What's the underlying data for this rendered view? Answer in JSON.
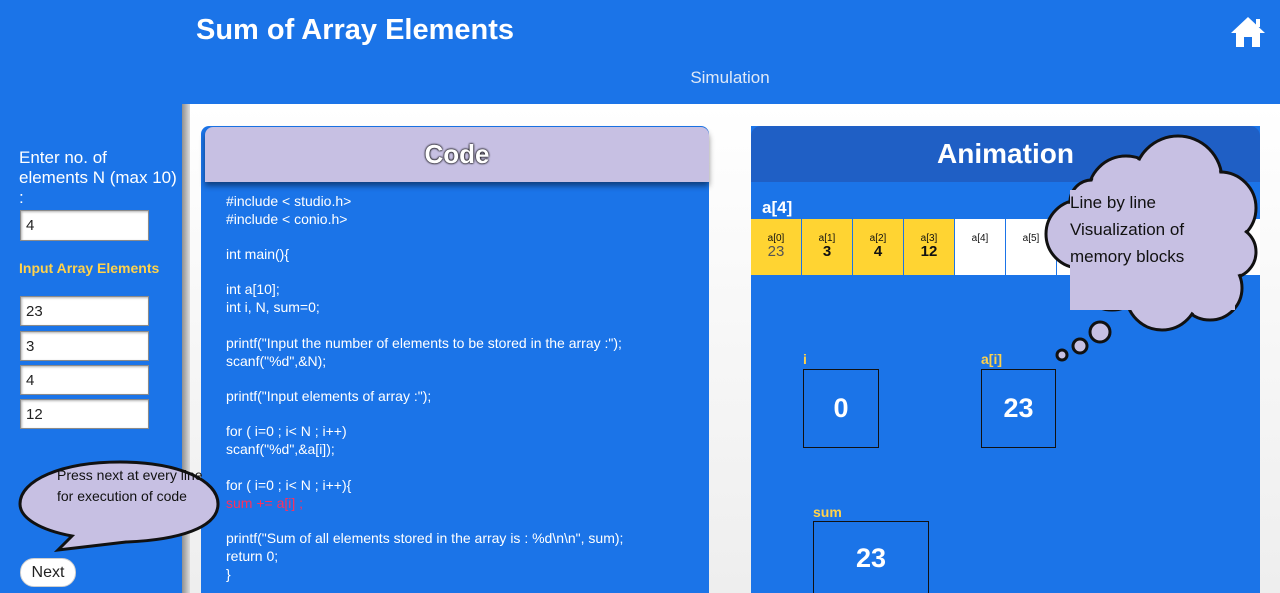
{
  "header": {
    "title": "Sum of Array Elements",
    "subtitle": "Simulation",
    "home_icon": "home-icon"
  },
  "sidebar": {
    "n_label": "Enter no. of elements N (max 10) :",
    "n_value": "4",
    "array_label": "Input Array Elements",
    "array_values": [
      "23",
      "3",
      "4",
      "12"
    ],
    "next_label": "Next",
    "hint": "Press next at every line for execution of code"
  },
  "code": {
    "title": "Code",
    "lines": [
      "#include < studio.h>",
      "#include < conio.h>",
      "int main(){",
      "int a[10];",
      "int i, N, sum=0;",
      "printf(\"Input the number of elements to be stored in the array :\");",
      "scanf(\"%d\",&N);",
      "printf(\"Input elements of array :\");",
      "for ( i=0 ; i< N ; i++)",
      "scanf(\"%d\",&a[i]);",
      "for ( i=0 ; i< N ; i++){",
      "sum += a[i] ;",
      "printf(\"Sum of all elements stored in the array is : %d\\n\\n\", sum);",
      "return 0;",
      "}"
    ],
    "highlighted_line": 11,
    "highlight_color": "#ff2f5c"
  },
  "animation": {
    "title": "Animation",
    "array_name": "a[4]",
    "cells": [
      {
        "index": "a[0]",
        "value": "23",
        "filled": true
      },
      {
        "index": "a[1]",
        "value": "3",
        "filled": true
      },
      {
        "index": "a[2]",
        "value": "4",
        "filled": true
      },
      {
        "index": "a[3]",
        "value": "12",
        "filled": true
      },
      {
        "index": "a[4]",
        "value": "",
        "filled": false
      },
      {
        "index": "a[5]",
        "value": "",
        "filled": false
      }
    ],
    "vars": {
      "i": {
        "label": "i",
        "value": "0"
      },
      "ai": {
        "label": "a[i]",
        "value": "23"
      },
      "sum": {
        "label": "sum",
        "value": "23"
      }
    },
    "bubble": [
      "Line by line",
      "Visualization of",
      "memory blocks"
    ]
  },
  "colors": {
    "primary": "#1b74e8",
    "highlight_yellow": "#ffd432",
    "label_yellow": "#ffd24a",
    "bubble_fill": "#c7c0e3"
  }
}
